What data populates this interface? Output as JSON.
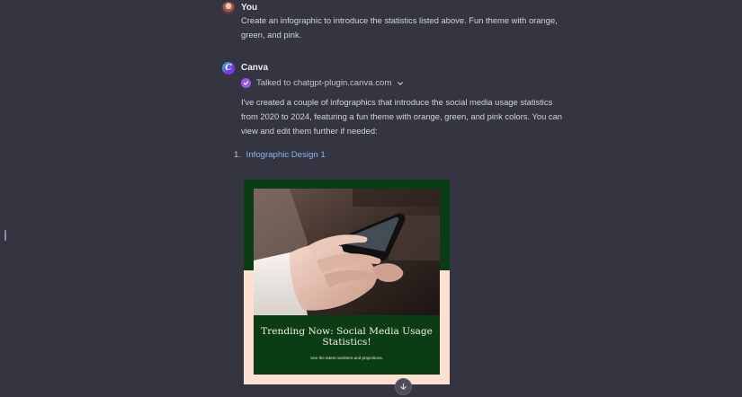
{
  "conversation": {
    "user_message": {
      "author": "You",
      "text": "Create an infographic to introduce the statistics listed above. Fun theme with orange, green, and pink."
    },
    "assistant_message": {
      "author": "Canva",
      "avatar_letter": "C",
      "plugin_status": "Talked to chatgpt-plugin.canva.com",
      "text": "I've created a couple of infographics that introduce the social media usage statistics from 2020 to 2024, featuring a fun theme with orange, green, and pink colors. You can view and edit them further if needed:",
      "list": [
        {
          "number": "1.",
          "link_text": "Infographic Design 1"
        }
      ]
    }
  },
  "infographic": {
    "title": "Trending Now: Social Media Usage Statistics!",
    "subtitle": "See the latest numbers and projections.",
    "colors": {
      "green": "#0b3d14",
      "peach": "#fde0cf"
    }
  },
  "icons": {
    "user_avatar": "user-avatar",
    "canva_avatar": "canva-logo-icon",
    "plugin_check": "check-circle-icon",
    "plugin_chevron": "chevron-down-icon",
    "scroll": "arrow-down-icon"
  },
  "theme": {
    "background": "#343541",
    "link": "#8ab4f8",
    "accent_purple": "#9b55f0"
  }
}
